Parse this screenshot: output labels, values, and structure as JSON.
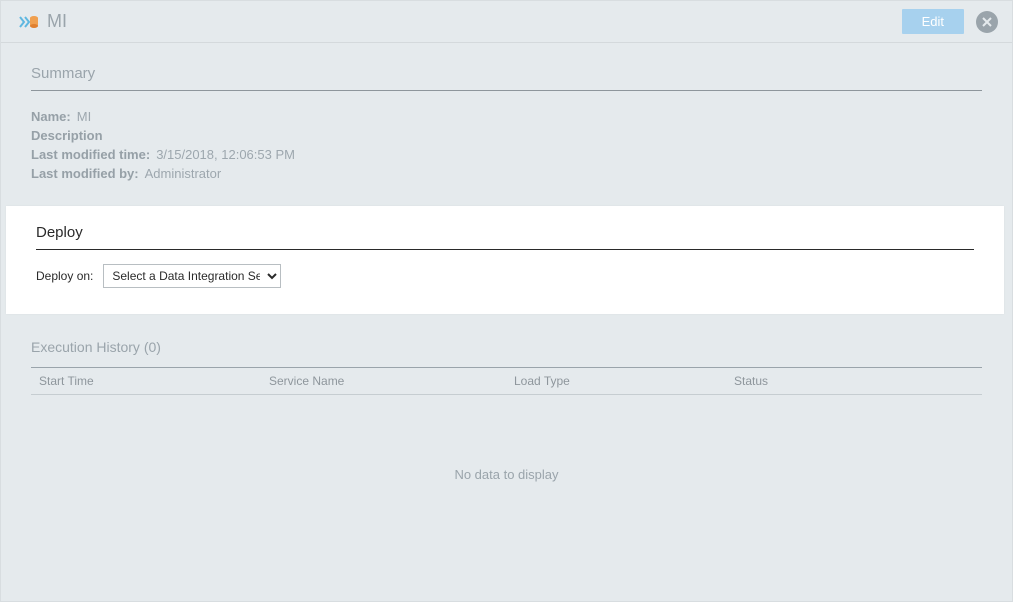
{
  "header": {
    "title": "MI",
    "edit_label": "Edit"
  },
  "summary": {
    "heading": "Summary",
    "name_label": "Name:",
    "name_value": "MI",
    "description_label": "Description",
    "description_value": "",
    "last_modified_time_label": "Last modified time:",
    "last_modified_time_value": "3/15/2018, 12:06:53 PM",
    "last_modified_by_label": "Last modified by:",
    "last_modified_by_value": "Administrator"
  },
  "deploy": {
    "heading": "Deploy",
    "deploy_on_label": "Deploy on:",
    "select_placeholder": "Select a Data Integration Ser"
  },
  "history": {
    "heading": "Execution History (0)",
    "columns": {
      "start_time": "Start Time",
      "service_name": "Service Name",
      "load_type": "Load Type",
      "status": "Status"
    },
    "no_data": "No data to display"
  }
}
